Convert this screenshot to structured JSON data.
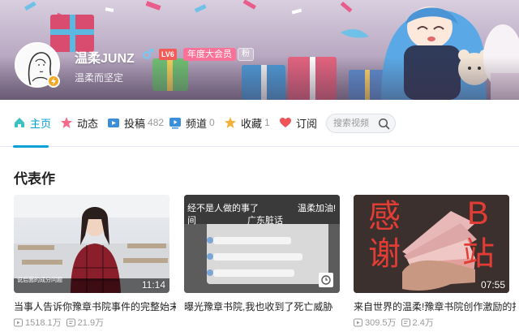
{
  "user": {
    "name": "温柔JUNZ",
    "level": "LV6",
    "vip_label": "年度大会员",
    "fan_label": "粉",
    "signature": "温柔而坚定"
  },
  "nav": {
    "items": [
      {
        "label": "主页",
        "count": "",
        "icon": "home-icon"
      },
      {
        "label": "动态",
        "count": "",
        "icon": "dynamic-icon"
      },
      {
        "label": "投稿",
        "count": "482",
        "icon": "upload-icon"
      },
      {
        "label": "频道",
        "count": "0",
        "icon": "channel-icon"
      },
      {
        "label": "收藏",
        "count": "1",
        "icon": "star-icon"
      },
      {
        "label": "订阅",
        "count": "",
        "icon": "heart-icon"
      }
    ],
    "search_placeholder": "搜索视频"
  },
  "section": {
    "title": "代表作"
  },
  "videos": [
    {
      "title": "当事人告诉你豫章书院事件的完整始末!",
      "duration": "11:14",
      "views": "1518.1万",
      "danmaku": "21.9万",
      "overlay_text": "说后面的成分问题"
    },
    {
      "title": "曝光豫章书院,我也收到了死亡威胁",
      "duration": "",
      "views": "",
      "danmaku": "",
      "overlay_lines": [
        "经不是人做的事了",
        "间",
        "温柔加油!",
        "广东脏话"
      ]
    },
    {
      "title": "来自世界的温柔!豫章书院创作激励的捐",
      "duration": "07:55",
      "views": "309.5万",
      "danmaku": "2.4万",
      "overlay_chars": [
        "感",
        "谢",
        "B",
        "站"
      ]
    }
  ],
  "colors": {
    "accent": "#00a1d6",
    "vip_pink": "#fb7299",
    "level_red": "#f25d59"
  }
}
